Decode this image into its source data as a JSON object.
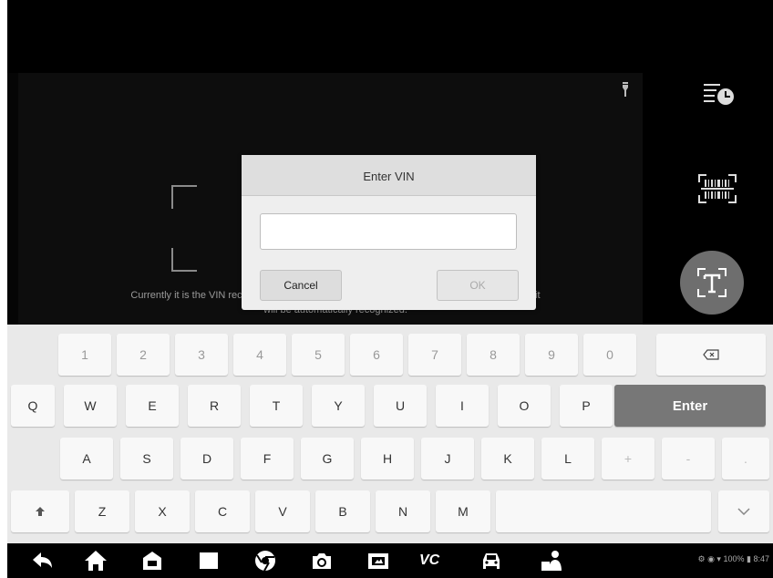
{
  "dialog": {
    "title": "Enter VIN",
    "input_value": "",
    "cancel_label": "Cancel",
    "ok_label": "OK"
  },
  "camera": {
    "hint_line1": "Currently it is the VIN rec",
    "hint_line1_tail": "nd it",
    "hint_line2": "will be automatically recognized."
  },
  "keyboard": {
    "row1": [
      "1",
      "2",
      "3",
      "4",
      "5",
      "6",
      "7",
      "8",
      "9",
      "0"
    ],
    "row2": [
      "Q",
      "W",
      "E",
      "R",
      "T",
      "Y",
      "U",
      "I",
      "O",
      "P"
    ],
    "row3": [
      "A",
      "S",
      "D",
      "F",
      "G",
      "H",
      "J",
      "K",
      "L",
      "+",
      "-",
      "."
    ],
    "row4": [
      "Z",
      "X",
      "C",
      "V",
      "B",
      "N",
      "M"
    ],
    "enter_label": "Enter",
    "backspace_icon": "backspace-icon",
    "shift_icon": "shift-arrow-icon",
    "hide_icon": "chevron-down-icon"
  },
  "navbar": {
    "icons": [
      "back-icon",
      "home-icon",
      "store-icon",
      "recent-apps-icon",
      "browser-icon",
      "camera-icon",
      "screenshot-icon",
      "vci-icon",
      "vehicle-icon",
      "remote-icon"
    ],
    "vc_label": "VC",
    "status_text": "100%",
    "time": "8:47"
  },
  "colors": {
    "enter_key": "#777777",
    "keyboard_bg": "#e9e9e9",
    "dialog_bg": "#eeeeee"
  }
}
